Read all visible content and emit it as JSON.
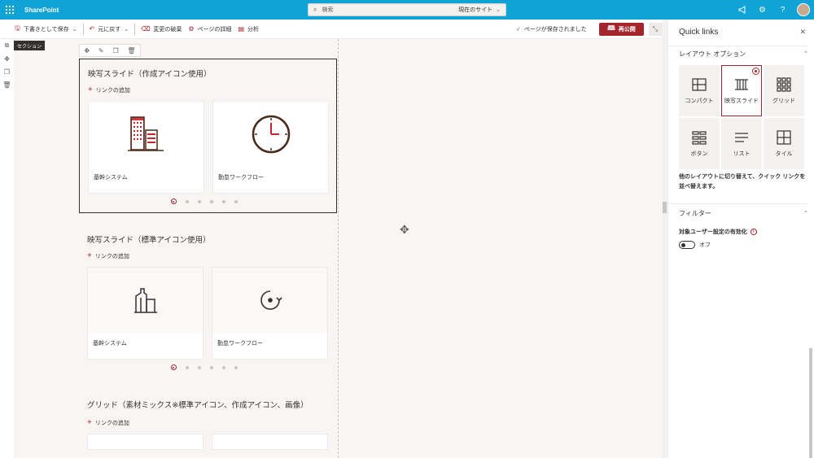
{
  "suite": {
    "brand": "SharePoint",
    "search_placeholder": "検索",
    "search_scope": "現在のサイト",
    "icons": [
      "megaphone-icon",
      "gear-icon",
      "help-icon"
    ]
  },
  "commandbar": {
    "save_draft": "下書きとして保存",
    "undo": "元に戻す",
    "discard": "変更の破棄",
    "page_details": "ページの詳細",
    "analytics": "分析",
    "saved_status": "ページが保存されました",
    "republish": "再公開"
  },
  "canvas": {
    "section_tag": "セクション",
    "webparts": [
      {
        "title": "映写スライド（作成アイコン使用）",
        "add_link": "リンクの追加",
        "cards": [
          {
            "label": "基幹システム",
            "icon": "building-color-icon"
          },
          {
            "label": "勤怠ワークフロー",
            "icon": "clock-color-icon"
          }
        ]
      },
      {
        "title": "映写スライド（標準アイコン使用）",
        "add_link": "リンクの追加",
        "cards": [
          {
            "label": "基幹システム",
            "icon": "building-outline-icon"
          },
          {
            "label": "勤怠ワークフロー",
            "icon": "refresh-clock-icon"
          }
        ]
      },
      {
        "title": "グリッド（素材ミックス※標準アイコン、作成アイコン、画像）",
        "add_link": "リンクの追加"
      }
    ]
  },
  "pane": {
    "title": "Quick links",
    "layout_section": "レイアウト オプション",
    "layouts": [
      {
        "label": "コンパクト",
        "icon": "compact-layout-icon",
        "selected": false
      },
      {
        "label": "映写スライド",
        "icon": "filmstrip-layout-icon",
        "selected": true
      },
      {
        "label": "グリッド",
        "icon": "grid-layout-icon",
        "selected": false
      },
      {
        "label": "ボタン",
        "icon": "button-layout-icon",
        "selected": false
      },
      {
        "label": "リスト",
        "icon": "list-layout-icon",
        "selected": false
      },
      {
        "label": "タイル",
        "icon": "tile-layout-icon",
        "selected": false
      }
    ],
    "description": "他のレイアウトに切り替えて、クイック リンクを並べ替えます。",
    "filter_section": "フィルター",
    "filter_label": "対象ユーザー設定の有効化",
    "toggle_state": "オフ"
  },
  "colors": {
    "suite_bar": "#0fa3d8",
    "accent": "#a4262c",
    "canvas_bg": "#faf5f5"
  }
}
